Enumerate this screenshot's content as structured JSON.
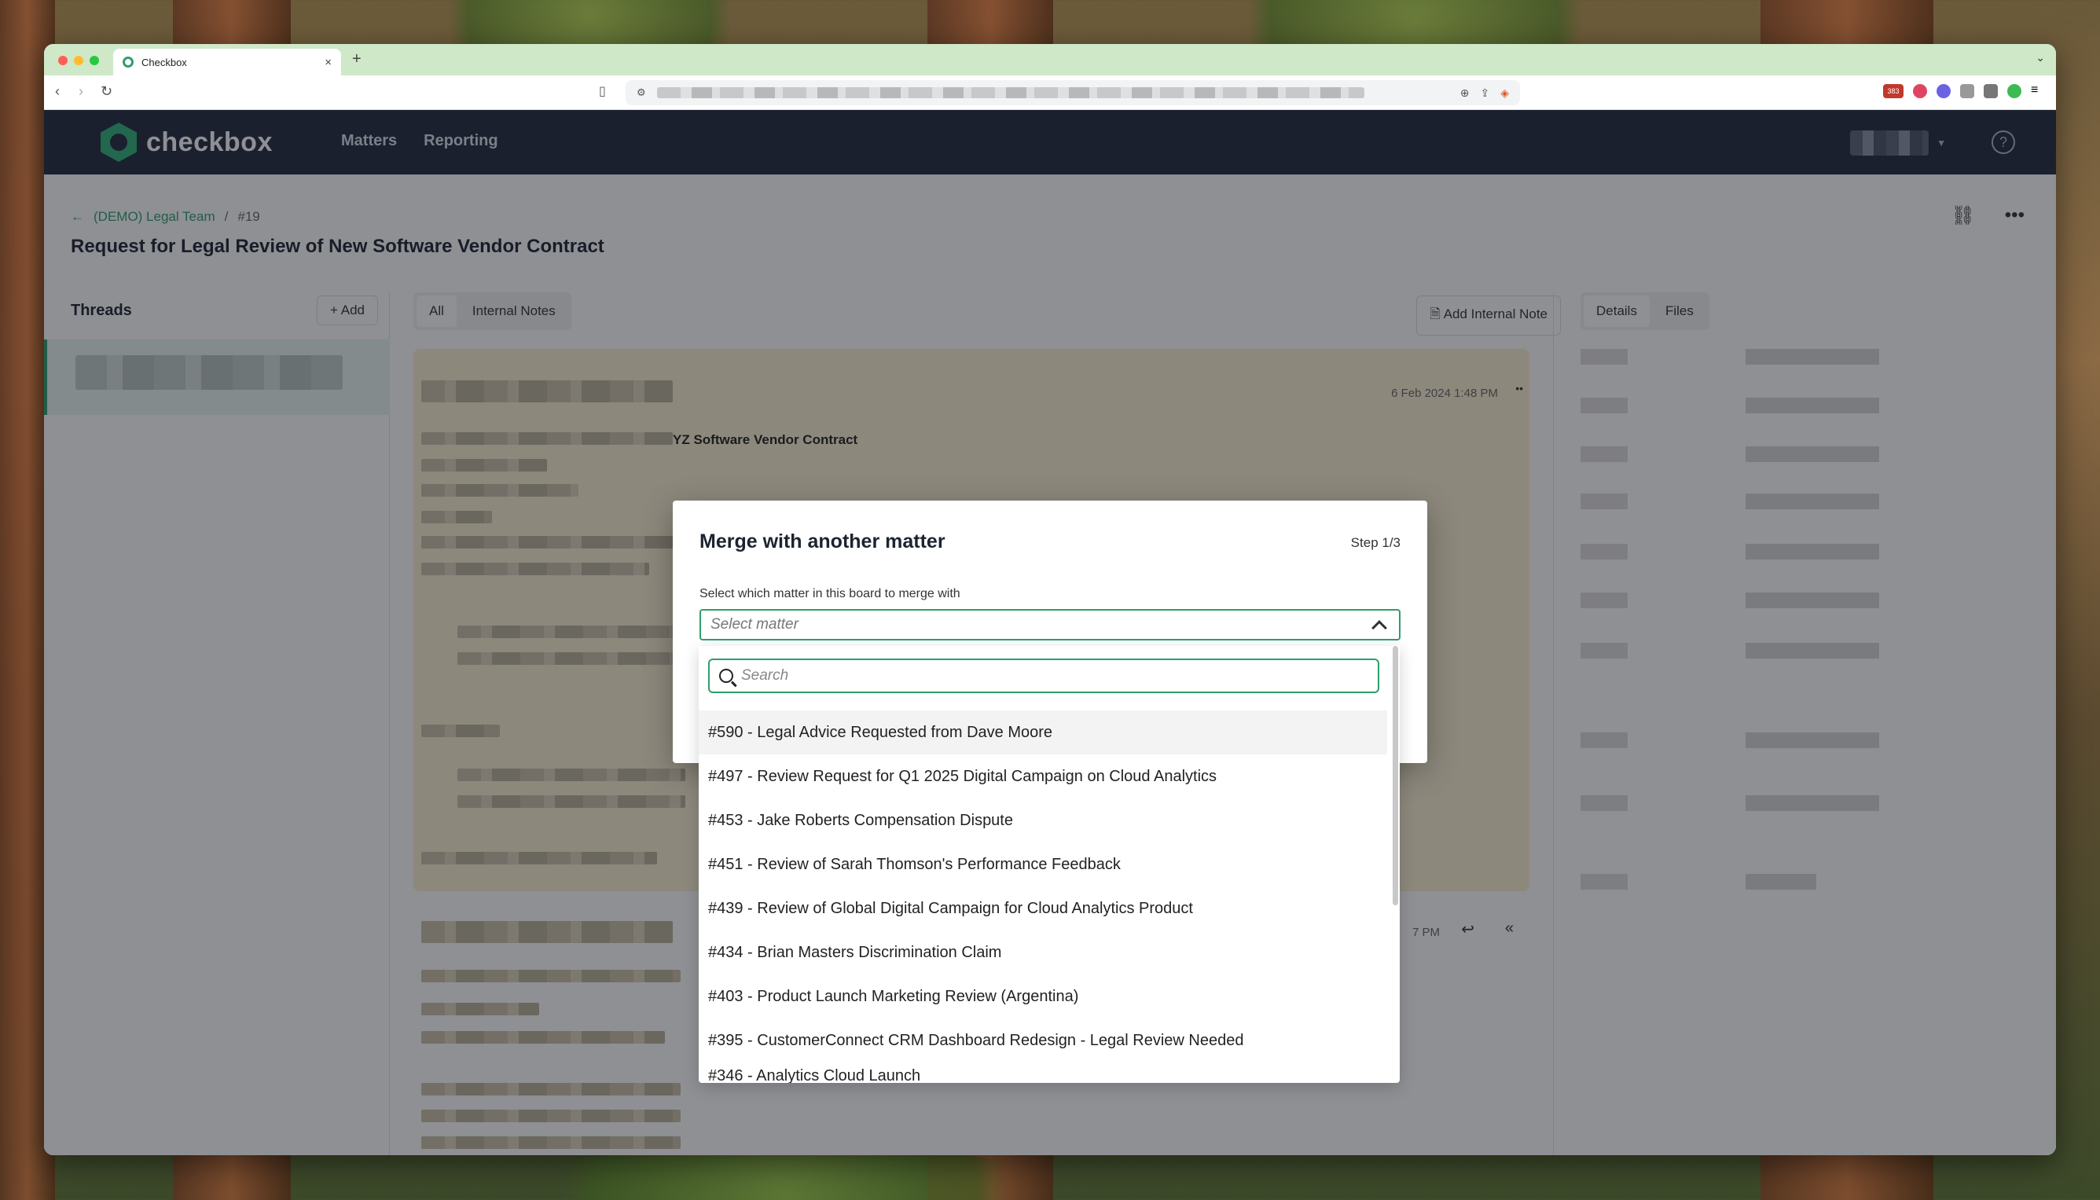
{
  "browser": {
    "tab_title": "Checkbox",
    "new_tab": "+",
    "tab_close": "×",
    "extension_badge": "383"
  },
  "app": {
    "brand": "checkbox",
    "nav": [
      "Matters",
      "Reporting"
    ],
    "help": "?",
    "breadcrumb": {
      "team": "(DEMO) Legal Team",
      "separator": "/",
      "number": "#19"
    },
    "title": "Request for Legal Review of New Software Vendor Contract",
    "threads": {
      "title": "Threads",
      "add_label": "Add"
    },
    "feed": {
      "filters": [
        "All",
        "Internal Notes"
      ],
      "add_note_label": "Add Internal Note",
      "message_date": "6 Feb 2024 1:48 PM",
      "message_subject_fragment": "YZ Software Vendor Contract",
      "message2_time_fragment": "7 PM"
    },
    "details": {
      "tabs": [
        "Details",
        "Files"
      ]
    }
  },
  "modal": {
    "title": "Merge with another matter",
    "step": "Step 1/3",
    "field_label": "Select which matter in this board to merge with",
    "select_placeholder": "Select matter",
    "search_placeholder": "Search",
    "options": [
      "#590 - Legal Advice Requested from Dave Moore",
      "#497 - Review Request for Q1 2025 Digital Campaign on Cloud Analytics",
      "#453 - Jake Roberts Compensation Dispute",
      "#451 - Review of Sarah Thomson's Performance Feedback",
      "#439 - Review of Global Digital Campaign for Cloud Analytics Product",
      "#434 - Brian Masters Discrimination Claim",
      "#403 - Product Launch Marketing Review (Argentina)",
      "#395 - CustomerConnect CRM Dashboard Redesign - Legal Review Needed",
      "#346 - Analytics Cloud Launch"
    ],
    "hover_index": 0
  },
  "colors": {
    "accent": "#2f9e6d",
    "header_bg": "#1f2a3c",
    "note_bg": "#fbf0d2"
  }
}
